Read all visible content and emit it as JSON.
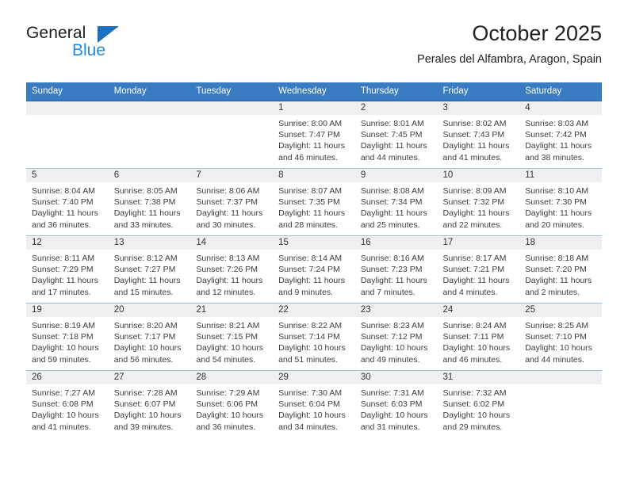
{
  "brand": {
    "word_one": "General",
    "word_two": "Blue",
    "triangle_icon": "brand-triangle-icon"
  },
  "header": {
    "title": "October 2025",
    "subtitle": "Perales del Alfambra, Aragon, Spain"
  },
  "colors": {
    "header_blue": "#3a7cc1",
    "brand_blue": "#1e8ce0",
    "brand_triangle": "#1d6fc0",
    "week_divider": "#9dbfe0",
    "first_week_divider": "#2f6fb5",
    "daybar_gray": "#efefef",
    "text": "#222222"
  },
  "weekdays": [
    "Sunday",
    "Monday",
    "Tuesday",
    "Wednesday",
    "Thursday",
    "Friday",
    "Saturday"
  ],
  "labels": {
    "sunrise_prefix": "Sunrise:",
    "sunset_prefix": "Sunset:",
    "daylight_prefix": "Daylight:"
  },
  "weeks": [
    [
      {
        "day": "",
        "empty": true
      },
      {
        "day": "",
        "empty": true
      },
      {
        "day": "",
        "empty": true
      },
      {
        "day": "1",
        "sunrise": "Sunrise: 8:00 AM",
        "sunset": "Sunset: 7:47 PM",
        "daylight": "Daylight: 11 hours and 46 minutes."
      },
      {
        "day": "2",
        "sunrise": "Sunrise: 8:01 AM",
        "sunset": "Sunset: 7:45 PM",
        "daylight": "Daylight: 11 hours and 44 minutes."
      },
      {
        "day": "3",
        "sunrise": "Sunrise: 8:02 AM",
        "sunset": "Sunset: 7:43 PM",
        "daylight": "Daylight: 11 hours and 41 minutes."
      },
      {
        "day": "4",
        "sunrise": "Sunrise: 8:03 AM",
        "sunset": "Sunset: 7:42 PM",
        "daylight": "Daylight: 11 hours and 38 minutes."
      }
    ],
    [
      {
        "day": "5",
        "sunrise": "Sunrise: 8:04 AM",
        "sunset": "Sunset: 7:40 PM",
        "daylight": "Daylight: 11 hours and 36 minutes."
      },
      {
        "day": "6",
        "sunrise": "Sunrise: 8:05 AM",
        "sunset": "Sunset: 7:38 PM",
        "daylight": "Daylight: 11 hours and 33 minutes."
      },
      {
        "day": "7",
        "sunrise": "Sunrise: 8:06 AM",
        "sunset": "Sunset: 7:37 PM",
        "daylight": "Daylight: 11 hours and 30 minutes."
      },
      {
        "day": "8",
        "sunrise": "Sunrise: 8:07 AM",
        "sunset": "Sunset: 7:35 PM",
        "daylight": "Daylight: 11 hours and 28 minutes."
      },
      {
        "day": "9",
        "sunrise": "Sunrise: 8:08 AM",
        "sunset": "Sunset: 7:34 PM",
        "daylight": "Daylight: 11 hours and 25 minutes."
      },
      {
        "day": "10",
        "sunrise": "Sunrise: 8:09 AM",
        "sunset": "Sunset: 7:32 PM",
        "daylight": "Daylight: 11 hours and 22 minutes."
      },
      {
        "day": "11",
        "sunrise": "Sunrise: 8:10 AM",
        "sunset": "Sunset: 7:30 PM",
        "daylight": "Daylight: 11 hours and 20 minutes."
      }
    ],
    [
      {
        "day": "12",
        "sunrise": "Sunrise: 8:11 AM",
        "sunset": "Sunset: 7:29 PM",
        "daylight": "Daylight: 11 hours and 17 minutes."
      },
      {
        "day": "13",
        "sunrise": "Sunrise: 8:12 AM",
        "sunset": "Sunset: 7:27 PM",
        "daylight": "Daylight: 11 hours and 15 minutes."
      },
      {
        "day": "14",
        "sunrise": "Sunrise: 8:13 AM",
        "sunset": "Sunset: 7:26 PM",
        "daylight": "Daylight: 11 hours and 12 minutes."
      },
      {
        "day": "15",
        "sunrise": "Sunrise: 8:14 AM",
        "sunset": "Sunset: 7:24 PM",
        "daylight": "Daylight: 11 hours and 9 minutes."
      },
      {
        "day": "16",
        "sunrise": "Sunrise: 8:16 AM",
        "sunset": "Sunset: 7:23 PM",
        "daylight": "Daylight: 11 hours and 7 minutes."
      },
      {
        "day": "17",
        "sunrise": "Sunrise: 8:17 AM",
        "sunset": "Sunset: 7:21 PM",
        "daylight": "Daylight: 11 hours and 4 minutes."
      },
      {
        "day": "18",
        "sunrise": "Sunrise: 8:18 AM",
        "sunset": "Sunset: 7:20 PM",
        "daylight": "Daylight: 11 hours and 2 minutes."
      }
    ],
    [
      {
        "day": "19",
        "sunrise": "Sunrise: 8:19 AM",
        "sunset": "Sunset: 7:18 PM",
        "daylight": "Daylight: 10 hours and 59 minutes."
      },
      {
        "day": "20",
        "sunrise": "Sunrise: 8:20 AM",
        "sunset": "Sunset: 7:17 PM",
        "daylight": "Daylight: 10 hours and 56 minutes."
      },
      {
        "day": "21",
        "sunrise": "Sunrise: 8:21 AM",
        "sunset": "Sunset: 7:15 PM",
        "daylight": "Daylight: 10 hours and 54 minutes."
      },
      {
        "day": "22",
        "sunrise": "Sunrise: 8:22 AM",
        "sunset": "Sunset: 7:14 PM",
        "daylight": "Daylight: 10 hours and 51 minutes."
      },
      {
        "day": "23",
        "sunrise": "Sunrise: 8:23 AM",
        "sunset": "Sunset: 7:12 PM",
        "daylight": "Daylight: 10 hours and 49 minutes."
      },
      {
        "day": "24",
        "sunrise": "Sunrise: 8:24 AM",
        "sunset": "Sunset: 7:11 PM",
        "daylight": "Daylight: 10 hours and 46 minutes."
      },
      {
        "day": "25",
        "sunrise": "Sunrise: 8:25 AM",
        "sunset": "Sunset: 7:10 PM",
        "daylight": "Daylight: 10 hours and 44 minutes."
      }
    ],
    [
      {
        "day": "26",
        "sunrise": "Sunrise: 7:27 AM",
        "sunset": "Sunset: 6:08 PM",
        "daylight": "Daylight: 10 hours and 41 minutes."
      },
      {
        "day": "27",
        "sunrise": "Sunrise: 7:28 AM",
        "sunset": "Sunset: 6:07 PM",
        "daylight": "Daylight: 10 hours and 39 minutes."
      },
      {
        "day": "28",
        "sunrise": "Sunrise: 7:29 AM",
        "sunset": "Sunset: 6:06 PM",
        "daylight": "Daylight: 10 hours and 36 minutes."
      },
      {
        "day": "29",
        "sunrise": "Sunrise: 7:30 AM",
        "sunset": "Sunset: 6:04 PM",
        "daylight": "Daylight: 10 hours and 34 minutes."
      },
      {
        "day": "30",
        "sunrise": "Sunrise: 7:31 AM",
        "sunset": "Sunset: 6:03 PM",
        "daylight": "Daylight: 10 hours and 31 minutes."
      },
      {
        "day": "31",
        "sunrise": "Sunrise: 7:32 AM",
        "sunset": "Sunset: 6:02 PM",
        "daylight": "Daylight: 10 hours and 29 minutes."
      },
      {
        "day": "",
        "empty": true
      }
    ]
  ]
}
